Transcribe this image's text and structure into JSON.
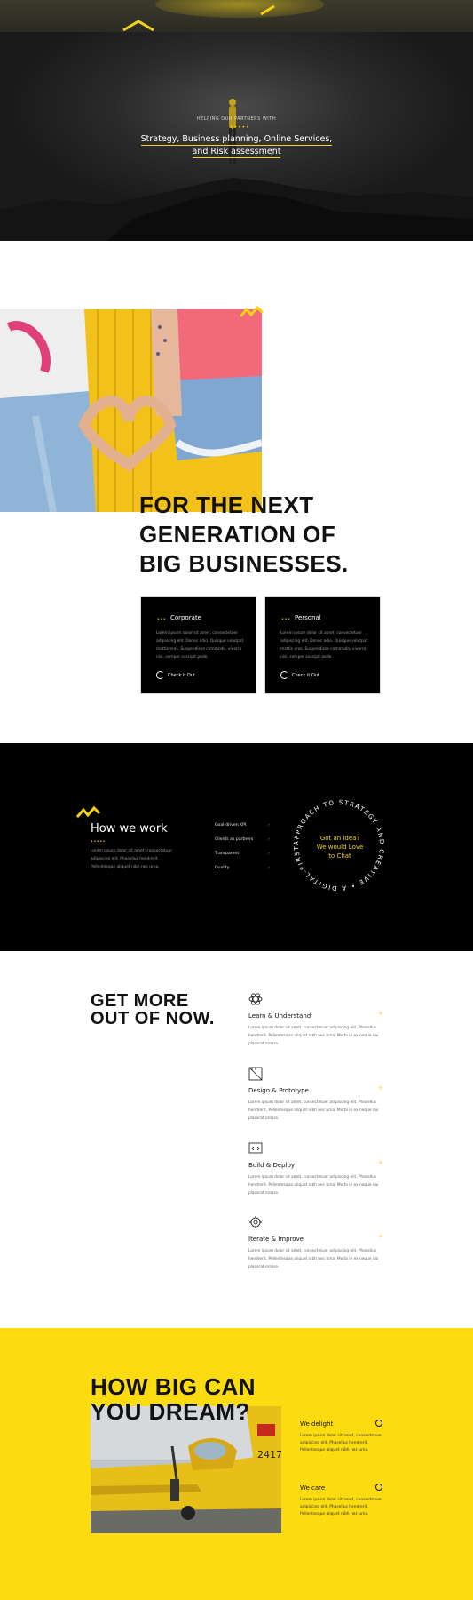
{
  "hero": {
    "eyebrow": "HELPING OUR PARTNERS WITH",
    "dots": "•••••",
    "line1": "Strategy, Business planning, Online Services,",
    "line2": "and Risk assessment"
  },
  "intro": {
    "title_lines": [
      "FOR THE NEXT",
      "GENERATION OF",
      "BIG BUSINESSES."
    ],
    "cards": [
      {
        "dots": "•••",
        "title": "Corporate",
        "body": "Lorem ipsum dolor sit amet, consectetuer adipiscing elit. Donec odio. Quisque volutpat mattis eros. Suspendisse commodo, viverra nisi, semper suscipit pede.",
        "cta": "Check it Out"
      },
      {
        "dots": "•••",
        "title": "Personal",
        "body": "Lorem ipsum dolor sit amet, consectetuer adipiscing elit. Donec odio. Quisque volutpat mattis eros. Suspendisse commodo, viverra nisi, semper suscipit pede.",
        "cta": "Check it Out"
      }
    ]
  },
  "how": {
    "title": "How we work",
    "dots": "•••••",
    "body": "Lorem ipsum dolor sit amet, consectetuer adipiscing elit. Phasellus hendrerit. Pellentesque aliquet nibh nec urna.",
    "list": [
      {
        "label": "Goal-driven KPI",
        "arrow": "›"
      },
      {
        "label": "Clients as partners",
        "arrow": "›"
      },
      {
        "label": "Transparent",
        "arrow": "›"
      },
      {
        "label": "Quality",
        "arrow": "›"
      }
    ],
    "circle_text": "APPROACH TO STRATEGY AND CREATIVE • A DIGITAL-FIRST ",
    "center_lines": [
      "Got an idea?",
      "We would Love",
      "to Chat"
    ]
  },
  "process": {
    "title_lines": [
      "GET MORE",
      "OUT OF NOW."
    ],
    "steps": [
      {
        "icon": "atom-icon",
        "name": "Learn & Understand",
        "plus": "+",
        "text": "Lorem ipsum dolor sit amet, consectetuer adipiscing elit. Phasellus hendrerit. Pellentesque aliquet nibh nec urna. Morbi in ex neque dui placerat ornare."
      },
      {
        "icon": "ruler-icon",
        "name": "Design & Prototype",
        "plus": "+",
        "text": "Lorem ipsum dolor sit amet, consectetuer adipiscing elit. Phasellus hendrerit. Pellentesque aliquet nibh nec urna. Morbi in ex neque dui placerat ornare."
      },
      {
        "icon": "code-icon",
        "name": "Build & Deploy",
        "plus": "+",
        "text": "Lorem ipsum dolor sit amet, consectetuer adipiscing elit. Phasellus hendrerit. Pellentesque aliquet nibh nec urna. Morbi in ex neque dui placerat ornare."
      },
      {
        "icon": "gear-icon",
        "name": "Iterate & Improve",
        "plus": "+",
        "text": "Lorem ipsum dolor sit amet, consectetuer adipiscing elit. Phasellus hendrerit. Pellentesque aliquet nibh nec urna. Morbi in ex neque dui placerat ornare."
      }
    ]
  },
  "dream": {
    "title_lines": [
      "HOW BIG CAN",
      "YOU DREAM?"
    ],
    "plane_tail": "2417",
    "features": [
      {
        "title": "We delight",
        "body": "Lorem ipsum dolor sit amet, consectetuer adipiscing elit. Phasellus hendrerit. Pellentesque aliquet nibh nec urna."
      },
      {
        "title": "We care",
        "body": "Lorem ipsum dolor sit amet, consectetuer adipiscing elit. Phasellus hendrerit. Pellentesque aliquet nibh nec urna."
      }
    ]
  },
  "colors": {
    "accent": "#fcdb11",
    "dark": "#000000",
    "text": "#111111"
  }
}
